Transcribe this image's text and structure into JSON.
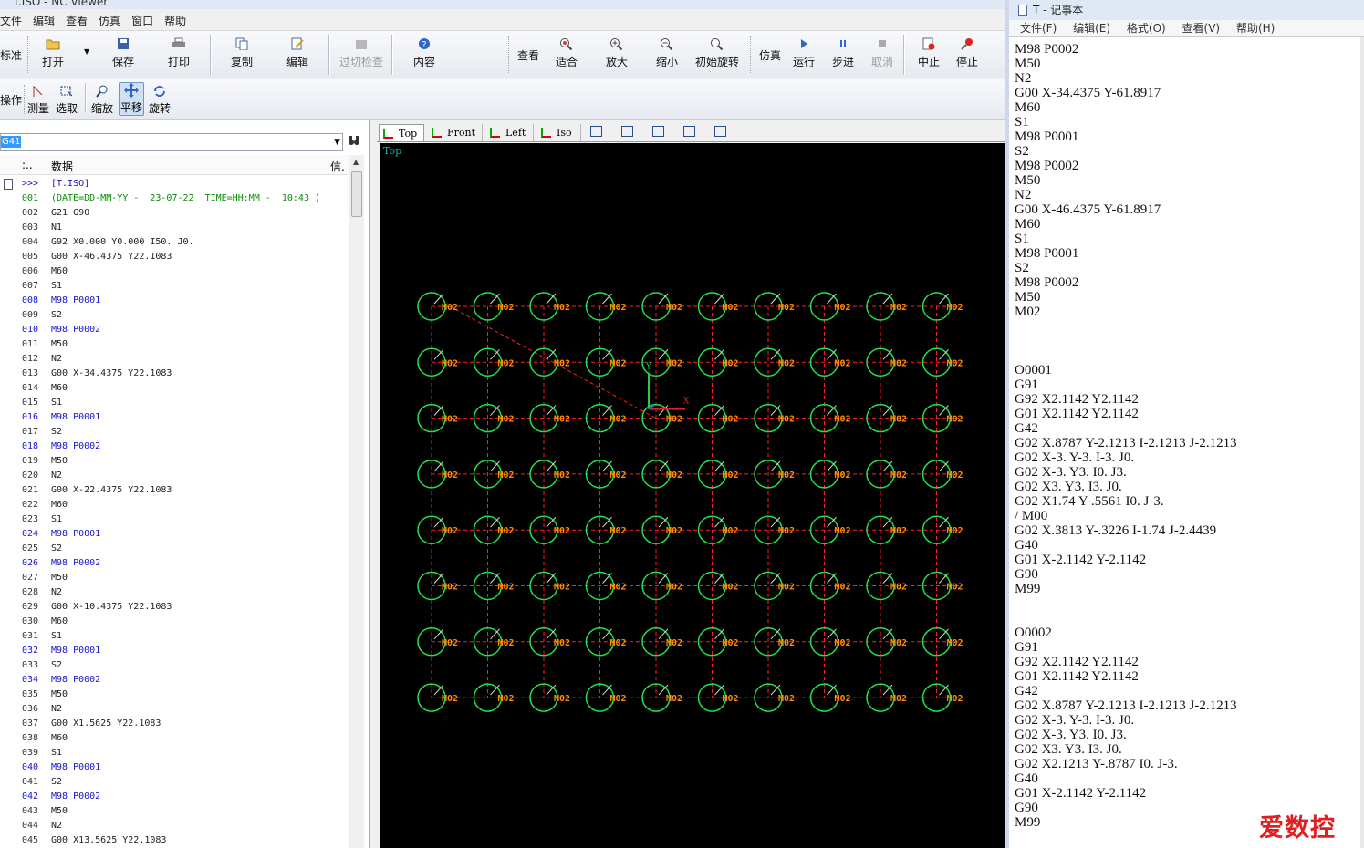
{
  "nc_window": {
    "title": "T.ISO - NC Viewer",
    "menu": [
      "文件",
      "编辑",
      "查看",
      "仿真",
      "窗口",
      "帮助"
    ],
    "toolbar1": {
      "standard_label": "标准",
      "open": "打开",
      "save": "保存",
      "print": "打印",
      "copy": "复制",
      "edit": "编辑",
      "overcut_check": "过切检查",
      "content": "内容",
      "view_label": "查看",
      "fit": "适合",
      "zoom_in": "放大",
      "zoom_out": "缩小",
      "initial_rotate": "初始旋转",
      "sim_label": "仿真",
      "run": "运行",
      "step": "步进",
      "cancel": "取消",
      "abort": "中止",
      "stop": "停止"
    },
    "toolbar2": {
      "ops_label": "操作",
      "measure": "测量",
      "select": "选取",
      "zoom": "缩放",
      "pan": "平移",
      "rotate": "旋转"
    },
    "code_panel": {
      "combo_value": "G41",
      "col_dots": ":..",
      "col_data": "数据",
      "col_info": "信.",
      "header_row": {
        "marker": ">>>",
        "text": "[T.ISO]"
      },
      "rows": [
        {
          "n": "001",
          "c": "(DATE=DD-MM-YY -  23-07-22  TIME=HH:MM -  10:43 )",
          "style": "green"
        },
        {
          "n": "002",
          "c": "G21 G90",
          "style": ""
        },
        {
          "n": "003",
          "c": "N1",
          "style": ""
        },
        {
          "n": "004",
          "c": "G92 X0.000 Y0.000 I50. J0.",
          "style": ""
        },
        {
          "n": "005",
          "c": "G00 X-46.4375 Y22.1083",
          "style": ""
        },
        {
          "n": "006",
          "c": "M60",
          "style": ""
        },
        {
          "n": "007",
          "c": "S1",
          "style": ""
        },
        {
          "n": "008",
          "c": "M98 P0001",
          "style": "blue"
        },
        {
          "n": "009",
          "c": "S2",
          "style": ""
        },
        {
          "n": "010",
          "c": "M98 P0002",
          "style": "blue"
        },
        {
          "n": "011",
          "c": "M50",
          "style": ""
        },
        {
          "n": "012",
          "c": "N2",
          "style": ""
        },
        {
          "n": "013",
          "c": "G00 X-34.4375 Y22.1083",
          "style": ""
        },
        {
          "n": "014",
          "c": "M60",
          "style": ""
        },
        {
          "n": "015",
          "c": "S1",
          "style": ""
        },
        {
          "n": "016",
          "c": "M98 P0001",
          "style": "blue"
        },
        {
          "n": "017",
          "c": "S2",
          "style": ""
        },
        {
          "n": "018",
          "c": "M98 P0002",
          "style": "blue"
        },
        {
          "n": "019",
          "c": "M50",
          "style": ""
        },
        {
          "n": "020",
          "c": "N2",
          "style": ""
        },
        {
          "n": "021",
          "c": "G00 X-22.4375 Y22.1083",
          "style": ""
        },
        {
          "n": "022",
          "c": "M60",
          "style": ""
        },
        {
          "n": "023",
          "c": "S1",
          "style": ""
        },
        {
          "n": "024",
          "c": "M98 P0001",
          "style": "blue"
        },
        {
          "n": "025",
          "c": "S2",
          "style": ""
        },
        {
          "n": "026",
          "c": "M98 P0002",
          "style": "blue"
        },
        {
          "n": "027",
          "c": "M50",
          "style": ""
        },
        {
          "n": "028",
          "c": "N2",
          "style": ""
        },
        {
          "n": "029",
          "c": "G00 X-10.4375 Y22.1083",
          "style": ""
        },
        {
          "n": "030",
          "c": "M60",
          "style": ""
        },
        {
          "n": "031",
          "c": "S1",
          "style": ""
        },
        {
          "n": "032",
          "c": "M98 P0001",
          "style": "blue"
        },
        {
          "n": "033",
          "c": "S2",
          "style": ""
        },
        {
          "n": "034",
          "c": "M98 P0002",
          "style": "blue"
        },
        {
          "n": "035",
          "c": "M50",
          "style": ""
        },
        {
          "n": "036",
          "c": "N2",
          "style": ""
        },
        {
          "n": "037",
          "c": "G00 X1.5625 Y22.1083",
          "style": ""
        },
        {
          "n": "038",
          "c": "M60",
          "style": ""
        },
        {
          "n": "039",
          "c": "S1",
          "style": ""
        },
        {
          "n": "040",
          "c": "M98 P0001",
          "style": "blue"
        },
        {
          "n": "041",
          "c": "S2",
          "style": ""
        },
        {
          "n": "042",
          "c": "M98 P0002",
          "style": "blue"
        },
        {
          "n": "043",
          "c": "M50",
          "style": ""
        },
        {
          "n": "044",
          "c": "N2",
          "style": ""
        },
        {
          "n": "045",
          "c": "G00 X13.5625 Y22.1083",
          "style": ""
        }
      ]
    },
    "view_tabs": [
      "Top",
      "Front",
      "Left",
      "Iso"
    ],
    "canvas": {
      "view_label": "Top",
      "hole_label": "M02",
      "axis_x": "X",
      "axis_y": "Y",
      "grid_cols": 10,
      "grid_rows": 8,
      "colors": {
        "circle": "#22e04a",
        "label": "#ff8c00",
        "rapid": "#ff2020",
        "background": "#000000"
      }
    }
  },
  "notepad": {
    "title": "T - 记事本",
    "menu": [
      "文件(F)",
      "编辑(E)",
      "格式(O)",
      "查看(V)",
      "帮助(H)"
    ],
    "lines": [
      "M98 P0002",
      "M50",
      "N2",
      "G00 X-34.4375 Y-61.8917",
      "M60",
      "S1",
      "M98 P0001",
      "S2",
      "M98 P0002",
      "M50",
      "N2",
      "G00 X-46.4375 Y-61.8917",
      "M60",
      "S1",
      "M98 P0001",
      "S2",
      "M98 P0002",
      "M50",
      "M02",
      "",
      "",
      "",
      "O0001",
      "G91",
      "G92 X2.1142 Y2.1142",
      "G01 X2.1142 Y2.1142",
      "G42",
      "G02 X.8787 Y-2.1213 I-2.1213 J-2.1213",
      "G02 X-3. Y-3. I-3. J0.",
      "G02 X-3. Y3. I0. J3.",
      "G02 X3. Y3. I3. J0.",
      "G02 X1.74 Y-.5561 I0. J-3.",
      "/ M00",
      "G02 X.3813 Y-.3226 I-1.74 J-2.4439",
      "G40",
      "G01 X-2.1142 Y-2.1142",
      "G90",
      "M99",
      "",
      "",
      "O0002",
      "G91",
      "G92 X2.1142 Y2.1142",
      "G01 X2.1142 Y2.1142",
      "G42",
      "G02 X.8787 Y-2.1213 I-2.1213 J-2.1213",
      "G02 X-3. Y-3. I-3. J0.",
      "G02 X-3. Y3. I0. J3.",
      "G02 X3. Y3. I3. J0.",
      "G02 X2.1213 Y-.8787 I0. J-3.",
      "G40",
      "G01 X-2.1142 Y-2.1142",
      "G90",
      "M99"
    ]
  },
  "watermark": "爱数控"
}
